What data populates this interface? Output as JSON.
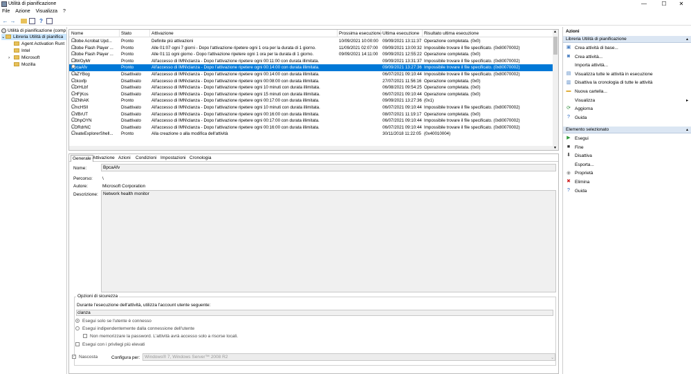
{
  "window": {
    "title": "Utilità di pianificazione",
    "controls": {
      "minimize": "—",
      "maximize": "☐",
      "close": "✕"
    }
  },
  "menu": [
    "File",
    "Azione",
    "Visualizza",
    "?"
  ],
  "tree": {
    "root": "Utilità di pianificazione (comp",
    "library": "Libreria Utilità di pianifica",
    "children": [
      "Agent Activation Runt",
      "Intel",
      "Microsoft",
      "Mozilla"
    ]
  },
  "tasks": {
    "columns": [
      "Nome",
      "Stato",
      "Attivazione",
      "Prossima esecuzione",
      "Ultima esecuzione",
      "Risultato ultima esecuzione"
    ],
    "selected_index": 4,
    "rows": [
      [
        "Adobe Acrobat Upd...",
        "Pronto",
        "Definite più attivazioni",
        "10/09/2021 10:00:00",
        "09/09/2021 13:11:37",
        "Operazione completata. (0x0)"
      ],
      [
        "Adobe Flash Player ...",
        "Pronto",
        "Alle 01:07 ogni 7 giorni - Dopo l'attivazione ripetere ogni 1 ora per la durata di 1 giorno.",
        "11/09/2021 02:07:00",
        "09/09/2021 13:00:32",
        "Impossibile trovare il file specificato. (0x80070002)"
      ],
      [
        "Adobe Flash Player ...",
        "Pronto",
        "Alle 01:11 ogni giorno - Dopo l'attivazione ripetere ogni 1 ora per la durata di 1 giorno.",
        "09/09/2021 14:11:00",
        "09/09/2021 12:55:22",
        "Operazione completata. (0x0)"
      ],
      [
        "adWOyMr",
        "Pronto",
        "All'accesso di IMN\\clanza - Dopo l'attivazione ripetere ogni 00:11:00 con durata illimitata.",
        "",
        "09/09/2021 13:31:37",
        "Impossibile trovare il file specificato. (0x80070002)"
      ],
      [
        "BpcaAfv",
        "Pronto",
        "All'accesso di IMN\\clanza - Dopo l'attivazione ripetere ogni 00:14:00 con durata illimitata.",
        "",
        "09/09/2021 13:27:36",
        "Impossibile trovare il file specificato. (0x80070002)"
      ],
      [
        "CaZYBog",
        "Disattivato",
        "All'accesso di IMN\\clanza - Dopo l'attivazione ripetere ogni 00:14:00 con durata illimitata.",
        "",
        "06/07/2021 09:10:44",
        "Impossibile trovare il file specificato. (0x80070002)"
      ],
      [
        "Cckoxfp",
        "Disattivato",
        "All'accesso di IMN\\clanza - Dopo l'attivazione ripetere ogni 00:08:00 con durata illimitata.",
        "",
        "27/07/2021 11:56:16",
        "Operazione completata. (0x0)"
      ],
      [
        "CDrHLbf",
        "Disattivato",
        "All'accesso di IMN\\clanza - Dopo l'attivazione ripetere ogni 10 minuti con durata illimitata.",
        "",
        "06/08/2021 09:54:25",
        "Operazione completata. (0x0)"
      ],
      [
        "CHFjKos",
        "Disattivato",
        "All'accesso di IMN\\clanza - Dopo l'attivazione ripetere ogni 15 minuti con durata illimitata.",
        "",
        "06/07/2021 09:10:44",
        "Operazione completata. (0x0)"
      ],
      [
        "ClZNhAK",
        "Pronto",
        "All'accesso di IMN\\clanza - Dopo l'attivazione ripetere ogni 00:17:00 con durata illimitata.",
        "",
        "09/09/2021 13:27:36",
        "(0x1)"
      ],
      [
        "CmcHSll",
        "Disattivato",
        "All'accesso di IMN\\clanza - Dopo l'attivazione ripetere ogni 10 minuti con durata illimitata.",
        "",
        "06/07/2021 09:10:44",
        "Impossibile trovare il file specificato. (0x80070002)"
      ],
      [
        "CnfBrUT",
        "Disattivato",
        "All'accesso di IMN\\clanza - Dopo l'attivazione ripetere ogni 00:16:00 con durata illimitata.",
        "",
        "08/07/2021 11:19:17",
        "Operazione completata. (0x0)"
      ],
      [
        "COhpOYN",
        "Disattivato",
        "All'accesso di IMN\\clanza - Dopo l'attivazione ripetere ogni 00:17:00 con durata illimitata.",
        "",
        "06/07/2021 09:10:44",
        "Impossibile trovare il file specificato. (0x80070002)"
      ],
      [
        "CORdrNC",
        "Disattivato",
        "All'accesso di IMN\\clanza - Dopo l'attivazione ripetere ogni 00:16:00 con durata illimitata.",
        "",
        "06/07/2021 09:10:44",
        "Impossibile trovare il file specificato. (0x80070002)"
      ],
      [
        "CreateExplorerShell...",
        "Pronto",
        "Alla creazione o alla modifica dell'attività",
        "",
        "30/11/2018 11:22:05",
        "(0x40010004)"
      ]
    ]
  },
  "detail": {
    "tabs": [
      "Generale",
      "Attivazione",
      "Azioni",
      "Condizioni",
      "Impostazioni",
      "Cronologia"
    ],
    "name_label": "Nome:",
    "name_value": "BpcaAfv",
    "path_label": "Percorso:",
    "path_value": "\\",
    "author_label": "Autore:",
    "author_value": "Microsoft Corporation",
    "desc_label": "Descrizione:",
    "desc_value": "Network health monitor",
    "security": {
      "title": "Opzioni di sicurezza",
      "account_label": "Durante l'esecuzione dell'attività, utilizza l'account utente seguente:",
      "account_value": "clanza",
      "opt_logged": "Esegui solo se l'utente è connesso",
      "opt_indep": "Esegui indipendentemente dalla connessione dell'utente",
      "opt_nopass": "Non memorizzare la password. L'attività avrà accesso solo a risorse locali.",
      "opt_highest": "Esegui con i privilegi più elevati",
      "hidden_label": "Nascosta",
      "config_label": "Configura per:",
      "config_value": "Windows® 7, Windows Server™ 2008 R2"
    }
  },
  "actions": {
    "title": "Azioni",
    "section1": "Libreria Utilità di pianificazione",
    "items1": [
      {
        "label": "Crea attività di base...",
        "icon": "create-basic-task-icon",
        "glyph": "▣",
        "color": "#4a7fc1"
      },
      {
        "label": "Crea attività...",
        "icon": "create-task-icon",
        "glyph": "◙",
        "color": "#4a7fc1"
      },
      {
        "label": "Importa attività...",
        "icon": "import-icon",
        "glyph": "",
        "color": "#888"
      },
      {
        "label": "Visualizza tutte le attività in esecuzione",
        "icon": "running-tasks-icon",
        "glyph": "▤",
        "color": "#4a7fc1"
      },
      {
        "label": "Disattiva la cronologia di tutte le attività",
        "icon": "history-icon",
        "glyph": "▥",
        "color": "#4a7fc1"
      },
      {
        "label": "Nuova cartella...",
        "icon": "new-folder-icon",
        "glyph": "▬",
        "color": "#e0b040"
      },
      {
        "label": "Visualizza",
        "icon": "view-icon",
        "glyph": "",
        "color": "#888"
      },
      {
        "label": "Aggiorna",
        "icon": "refresh-icon",
        "glyph": "⟳",
        "color": "#2e8b3a"
      },
      {
        "label": "Guida",
        "icon": "help-icon",
        "glyph": "?",
        "color": "#2060c0"
      }
    ],
    "section2": "Elemento selezionato",
    "items2": [
      {
        "label": "Esegui",
        "icon": "run-icon",
        "glyph": "▶",
        "color": "#2e9b3a"
      },
      {
        "label": "Fine",
        "icon": "end-icon",
        "glyph": "■",
        "color": "#333"
      },
      {
        "label": "Disattiva",
        "icon": "disable-icon",
        "glyph": "⬇",
        "color": "#444"
      },
      {
        "label": "Esporta...",
        "icon": "export-icon",
        "glyph": "",
        "color": "#888"
      },
      {
        "label": "Proprietà",
        "icon": "properties-icon",
        "glyph": "◉",
        "color": "#999"
      },
      {
        "label": "Elimina",
        "icon": "delete-icon",
        "glyph": "✖",
        "color": "#d02020"
      },
      {
        "label": "Guida",
        "icon": "help-icon",
        "glyph": "?",
        "color": "#2060c0"
      }
    ]
  }
}
